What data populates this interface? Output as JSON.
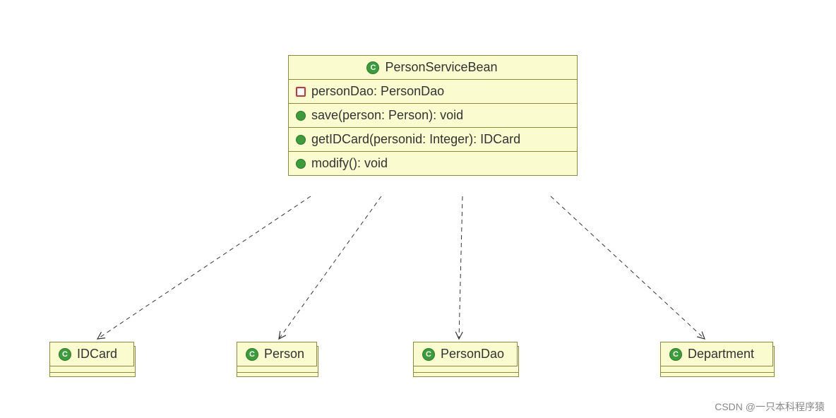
{
  "diagram": {
    "mainClass": {
      "name": "PersonServiceBean",
      "attributes": [
        {
          "visibility": "private",
          "signature": "personDao: PersonDao"
        }
      ],
      "methods": [
        {
          "visibility": "public",
          "signature": "save(person: Person): void"
        },
        {
          "visibility": "public",
          "signature": "getIDCard(personid: Integer): IDCard"
        },
        {
          "visibility": "public",
          "signature": "modify(): void"
        }
      ]
    },
    "dependencies": [
      {
        "name": "IDCard"
      },
      {
        "name": "Person"
      },
      {
        "name": "PersonDao"
      },
      {
        "name": "Department"
      }
    ],
    "relation": "dependency (dashed open arrow)"
  },
  "watermark": "CSDN @一只本科程序猿"
}
